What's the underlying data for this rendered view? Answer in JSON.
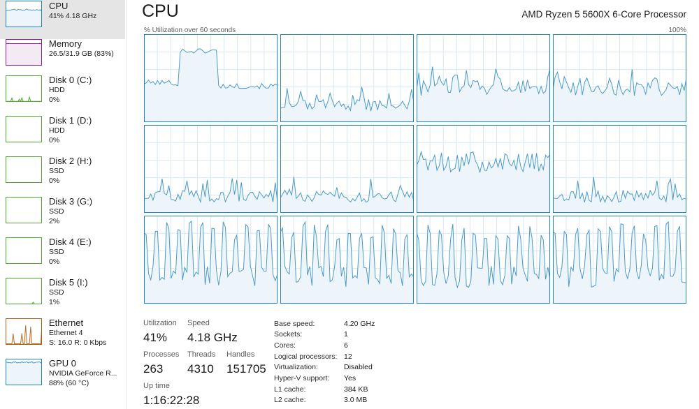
{
  "colors": {
    "cpu_line": "#4a9bc7",
    "cpu_fill": "#eef5fa",
    "cpu_border": "#1e85c7",
    "grid": "#d8e8f3",
    "memory_border": "#8b1e93",
    "disk_border": "#4ea72e",
    "ethernet_border": "#a75f1a",
    "gpu_border": "#1e85c7",
    "selected_bg": "#e5e5e5"
  },
  "sidebar": {
    "items": [
      {
        "name": "CPU",
        "sub1": "41% 4.18 GHz",
        "sub2": "",
        "icon": "cpu-mini-graph",
        "kind": "cpu",
        "selected": true
      },
      {
        "name": "Memory",
        "sub1": "26.5/31.9 GB (83%)",
        "sub2": "",
        "icon": "memory-mini-graph",
        "kind": "memory",
        "selected": false
      },
      {
        "name": "Disk 0 (C:)",
        "sub1": "HDD",
        "sub2": "0%",
        "icon": "disk-mini-graph",
        "kind": "disk-active",
        "selected": false
      },
      {
        "name": "Disk 1 (D:)",
        "sub1": "HDD",
        "sub2": "0%",
        "icon": "disk-mini-graph",
        "kind": "disk",
        "selected": false
      },
      {
        "name": "Disk 2 (H:)",
        "sub1": "SSD",
        "sub2": "0%",
        "icon": "disk-mini-graph",
        "kind": "disk",
        "selected": false
      },
      {
        "name": "Disk 3 (G:)",
        "sub1": "SSD",
        "sub2": "2%",
        "icon": "disk-mini-graph",
        "kind": "disk",
        "selected": false
      },
      {
        "name": "Disk 4 (E:)",
        "sub1": "SSD",
        "sub2": "0%",
        "icon": "disk-mini-graph",
        "kind": "disk",
        "selected": false
      },
      {
        "name": "Disk 5 (I:)",
        "sub1": "SSD",
        "sub2": "1%",
        "icon": "disk-mini-graph",
        "kind": "disk-tiny",
        "selected": false
      },
      {
        "name": "Ethernet",
        "sub1": "Ethernet 4",
        "sub2": "S: 16.0  R: 0 Kbps",
        "icon": "ethernet-mini-graph",
        "kind": "ethernet",
        "selected": false
      },
      {
        "name": "GPU 0",
        "sub1": "NVIDIA GeForce R...",
        "sub2": "88% (60 °C)",
        "icon": "gpu-mini-graph",
        "kind": "gpu",
        "selected": false
      }
    ]
  },
  "main": {
    "title": "CPU",
    "cpu_model": "AMD Ryzen 5 5600X 6-Core Processor",
    "graph_caption": "% Utilization over 60 seconds",
    "graph_max": "100%",
    "logical_processor_count": 12
  },
  "stats": {
    "utilization": {
      "label": "Utilization",
      "value": "41%"
    },
    "speed": {
      "label": "Speed",
      "value": "4.18 GHz"
    },
    "processes": {
      "label": "Processes",
      "value": "263"
    },
    "threads": {
      "label": "Threads",
      "value": "4310"
    },
    "handles": {
      "label": "Handles",
      "value": "151705"
    },
    "uptime": {
      "label": "Up time",
      "value": "1:16:22:28"
    }
  },
  "specs": [
    {
      "key": "Base speed:",
      "value": "4.20 GHz"
    },
    {
      "key": "Sockets:",
      "value": "1"
    },
    {
      "key": "Cores:",
      "value": "6"
    },
    {
      "key": "Logical processors:",
      "value": "12"
    },
    {
      "key": "Virtualization:",
      "value": "Disabled"
    },
    {
      "key": "Hyper-V support:",
      "value": "Yes"
    },
    {
      "key": "L1 cache:",
      "value": "384 KB"
    },
    {
      "key": "L2 cache:",
      "value": "3.0 MB"
    }
  ]
}
